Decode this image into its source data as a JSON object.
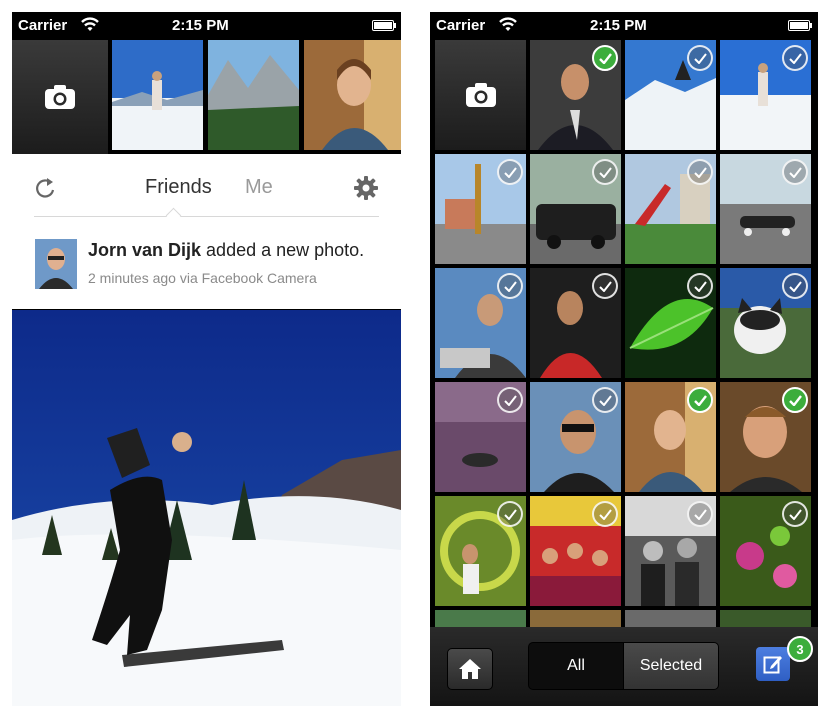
{
  "left_screen": {
    "status_bar": {
      "carrier": "Carrier",
      "time": "2:15 PM"
    },
    "tabs": {
      "friends": "Friends",
      "me": "Me"
    },
    "story": {
      "author": "Jorn van Dijk",
      "action": " added a new photo.",
      "meta": "2 minutes ago via Facebook Camera"
    }
  },
  "right_screen": {
    "status_bar": {
      "carrier": "Carrier",
      "time": "2:15 PM"
    },
    "segmented_control": {
      "all_label": "All",
      "selected_label": "Selected"
    },
    "selected_count": "3"
  },
  "colors": {
    "accent_green": "#3cad3c",
    "compose_blue": "#3f6fd6"
  }
}
